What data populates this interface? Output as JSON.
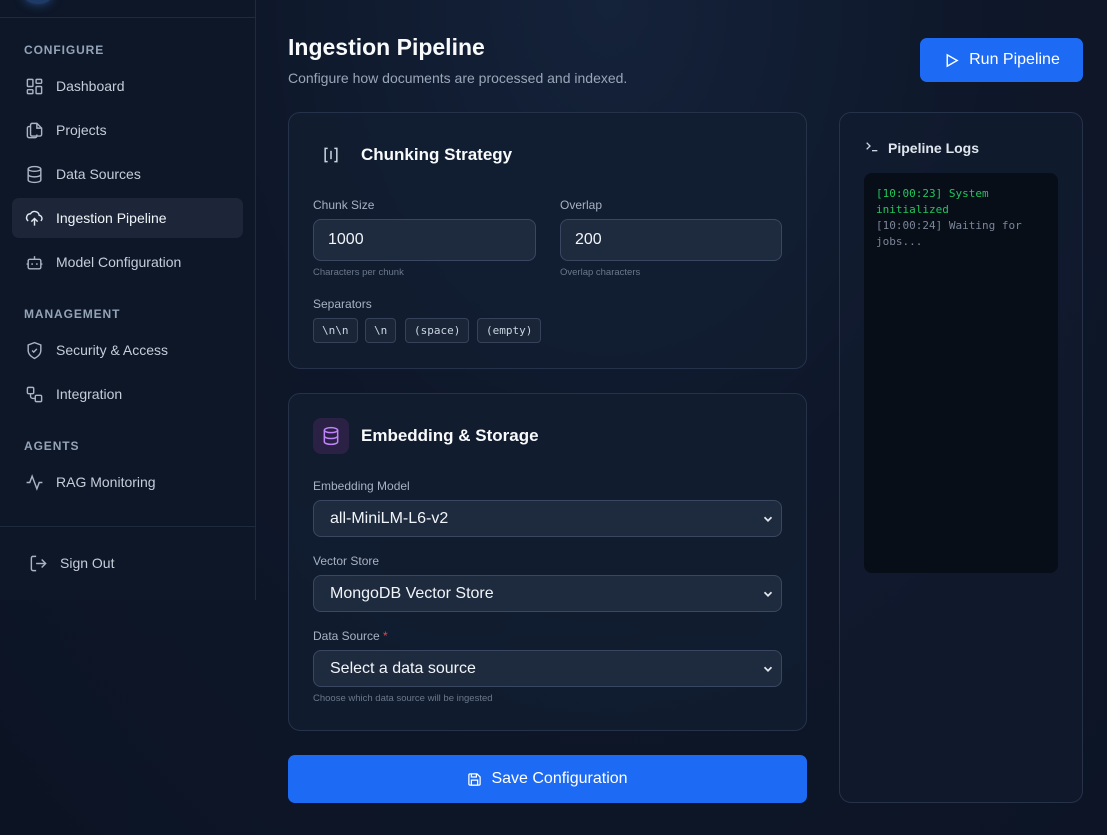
{
  "sidebar": {
    "sections": [
      {
        "label": "CONFIGURE"
      },
      {
        "label": "MANAGEMENT"
      },
      {
        "label": "AGENTS"
      }
    ],
    "items": [
      {
        "label": "Dashboard",
        "icon": "dashboard-icon"
      },
      {
        "label": "Projects",
        "icon": "files-icon"
      },
      {
        "label": "Data Sources",
        "icon": "database-icon"
      },
      {
        "label": "Ingestion Pipeline",
        "icon": "upload-cloud-icon",
        "active": true
      },
      {
        "label": "Model Configuration",
        "icon": "bot-icon"
      },
      {
        "label": "Security & Access",
        "icon": "shield-icon"
      },
      {
        "label": "Integration",
        "icon": "integration-icon"
      },
      {
        "label": "RAG Monitoring",
        "icon": "activity-icon"
      }
    ],
    "sign_out": "Sign Out"
  },
  "header": {
    "title": "Ingestion Pipeline",
    "subtitle": "Configure how documents are processed and indexed.",
    "run_button": "Run Pipeline"
  },
  "chunking": {
    "title": "Chunking Strategy",
    "chunk_size_label": "Chunk Size",
    "chunk_size_value": "1000",
    "chunk_size_hint": "Characters per chunk",
    "overlap_label": "Overlap",
    "overlap_value": "200",
    "overlap_hint": "Overlap characters",
    "separators_label": "Separators",
    "separators": [
      "\\n\\n",
      "\\n",
      "(space)",
      "(empty)"
    ]
  },
  "embedding": {
    "title": "Embedding & Storage",
    "model_label": "Embedding Model",
    "model_value": "all-MiniLM-L6-v2",
    "vector_store_label": "Vector Store",
    "vector_store_value": "MongoDB Vector Store",
    "data_source_label": "Data Source",
    "data_source_required": "*",
    "data_source_value": "Select a data source",
    "data_source_hint": "Choose which data source will be ingested"
  },
  "save_button": "Save Configuration",
  "logs": {
    "title": "Pipeline Logs",
    "lines": [
      {
        "text": "[10:00:23] System initialized",
        "status": "success"
      },
      {
        "text": "[10:00:24] Waiting for jobs...",
        "status": "muted"
      }
    ]
  },
  "colors": {
    "accent": "#1d6af5",
    "background": "#0d1626",
    "log_success": "#22c55e",
    "required": "#ef4444",
    "embedding_icon": "#c084fc"
  }
}
